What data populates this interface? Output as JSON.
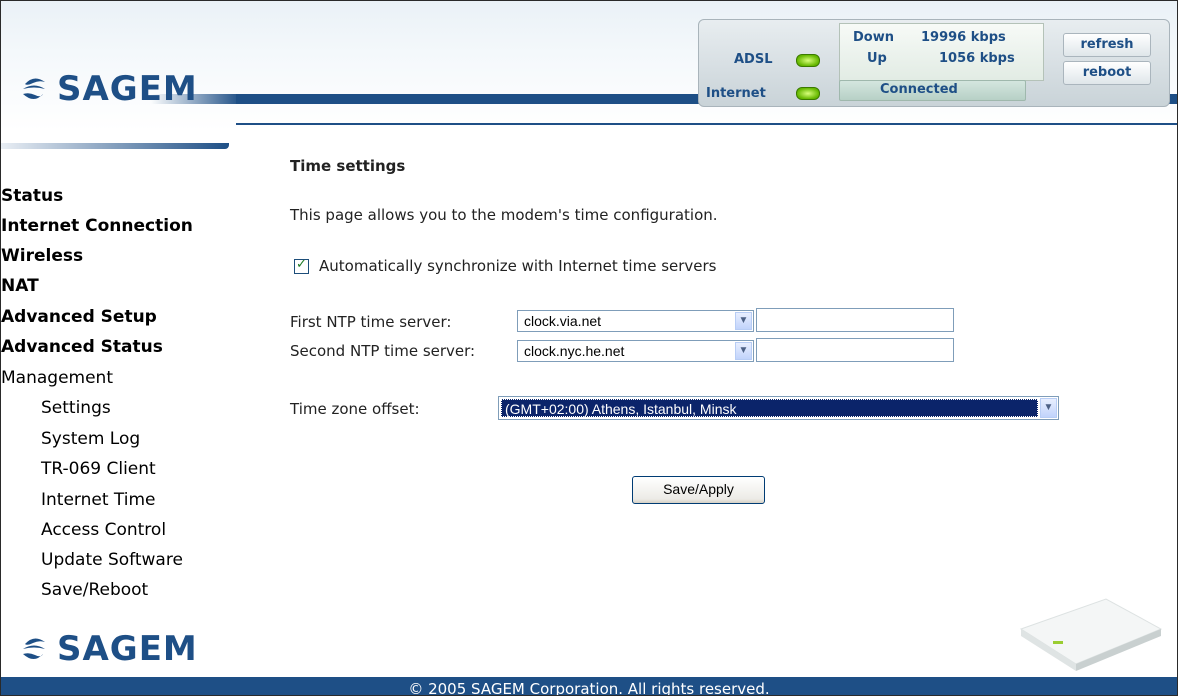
{
  "brand": {
    "name": "SAGEM"
  },
  "header": {
    "adsl_label": "ADSL",
    "internet_label": "Internet",
    "down_label": "Down",
    "down_value": "19996 kbps",
    "up_label": "Up",
    "up_value": "1056 kbps",
    "connection_status": "Connected",
    "refresh_label": "refresh",
    "reboot_label": "reboot"
  },
  "sidebar": {
    "items": [
      {
        "label": "Status",
        "level": "top"
      },
      {
        "label": "Internet Connection",
        "level": "top"
      },
      {
        "label": "Wireless",
        "level": "top"
      },
      {
        "label": "NAT",
        "level": "top"
      },
      {
        "label": "Advanced Setup",
        "level": "top"
      },
      {
        "label": "Advanced Status",
        "level": "top"
      },
      {
        "label": "Management",
        "level": "top"
      },
      {
        "label": "Settings",
        "level": "sub"
      },
      {
        "label": "System Log",
        "level": "sub"
      },
      {
        "label": "TR-069 Client",
        "level": "sub"
      },
      {
        "label": "Internet Time",
        "level": "sub"
      },
      {
        "label": "Access Control",
        "level": "sub"
      },
      {
        "label": "Update Software",
        "level": "sub"
      },
      {
        "label": "Save/Reboot",
        "level": "sub"
      }
    ]
  },
  "main": {
    "title": "Time settings",
    "description": "This page allows you to the modem's time configuration.",
    "auto_sync_label": "Automatically synchronize with Internet time servers",
    "auto_sync_checked": true,
    "ntp1_label": "First NTP time server:",
    "ntp1_value": "clock.via.net",
    "ntp1_other": "",
    "ntp2_label": "Second NTP time server:",
    "ntp2_value": "clock.nyc.he.net",
    "ntp2_other": "",
    "tz_label": "Time zone offset:",
    "tz_value": "(GMT+02:00) Athens, Istanbul, Minsk",
    "save_label": "Save/Apply"
  },
  "footer": {
    "copyright": "© 2005 SAGEM Corporation. All rights reserved."
  },
  "colors": {
    "brand_blue": "#1e4f86",
    "led_green": "#66b800",
    "selection_blue": "#0b246a"
  }
}
